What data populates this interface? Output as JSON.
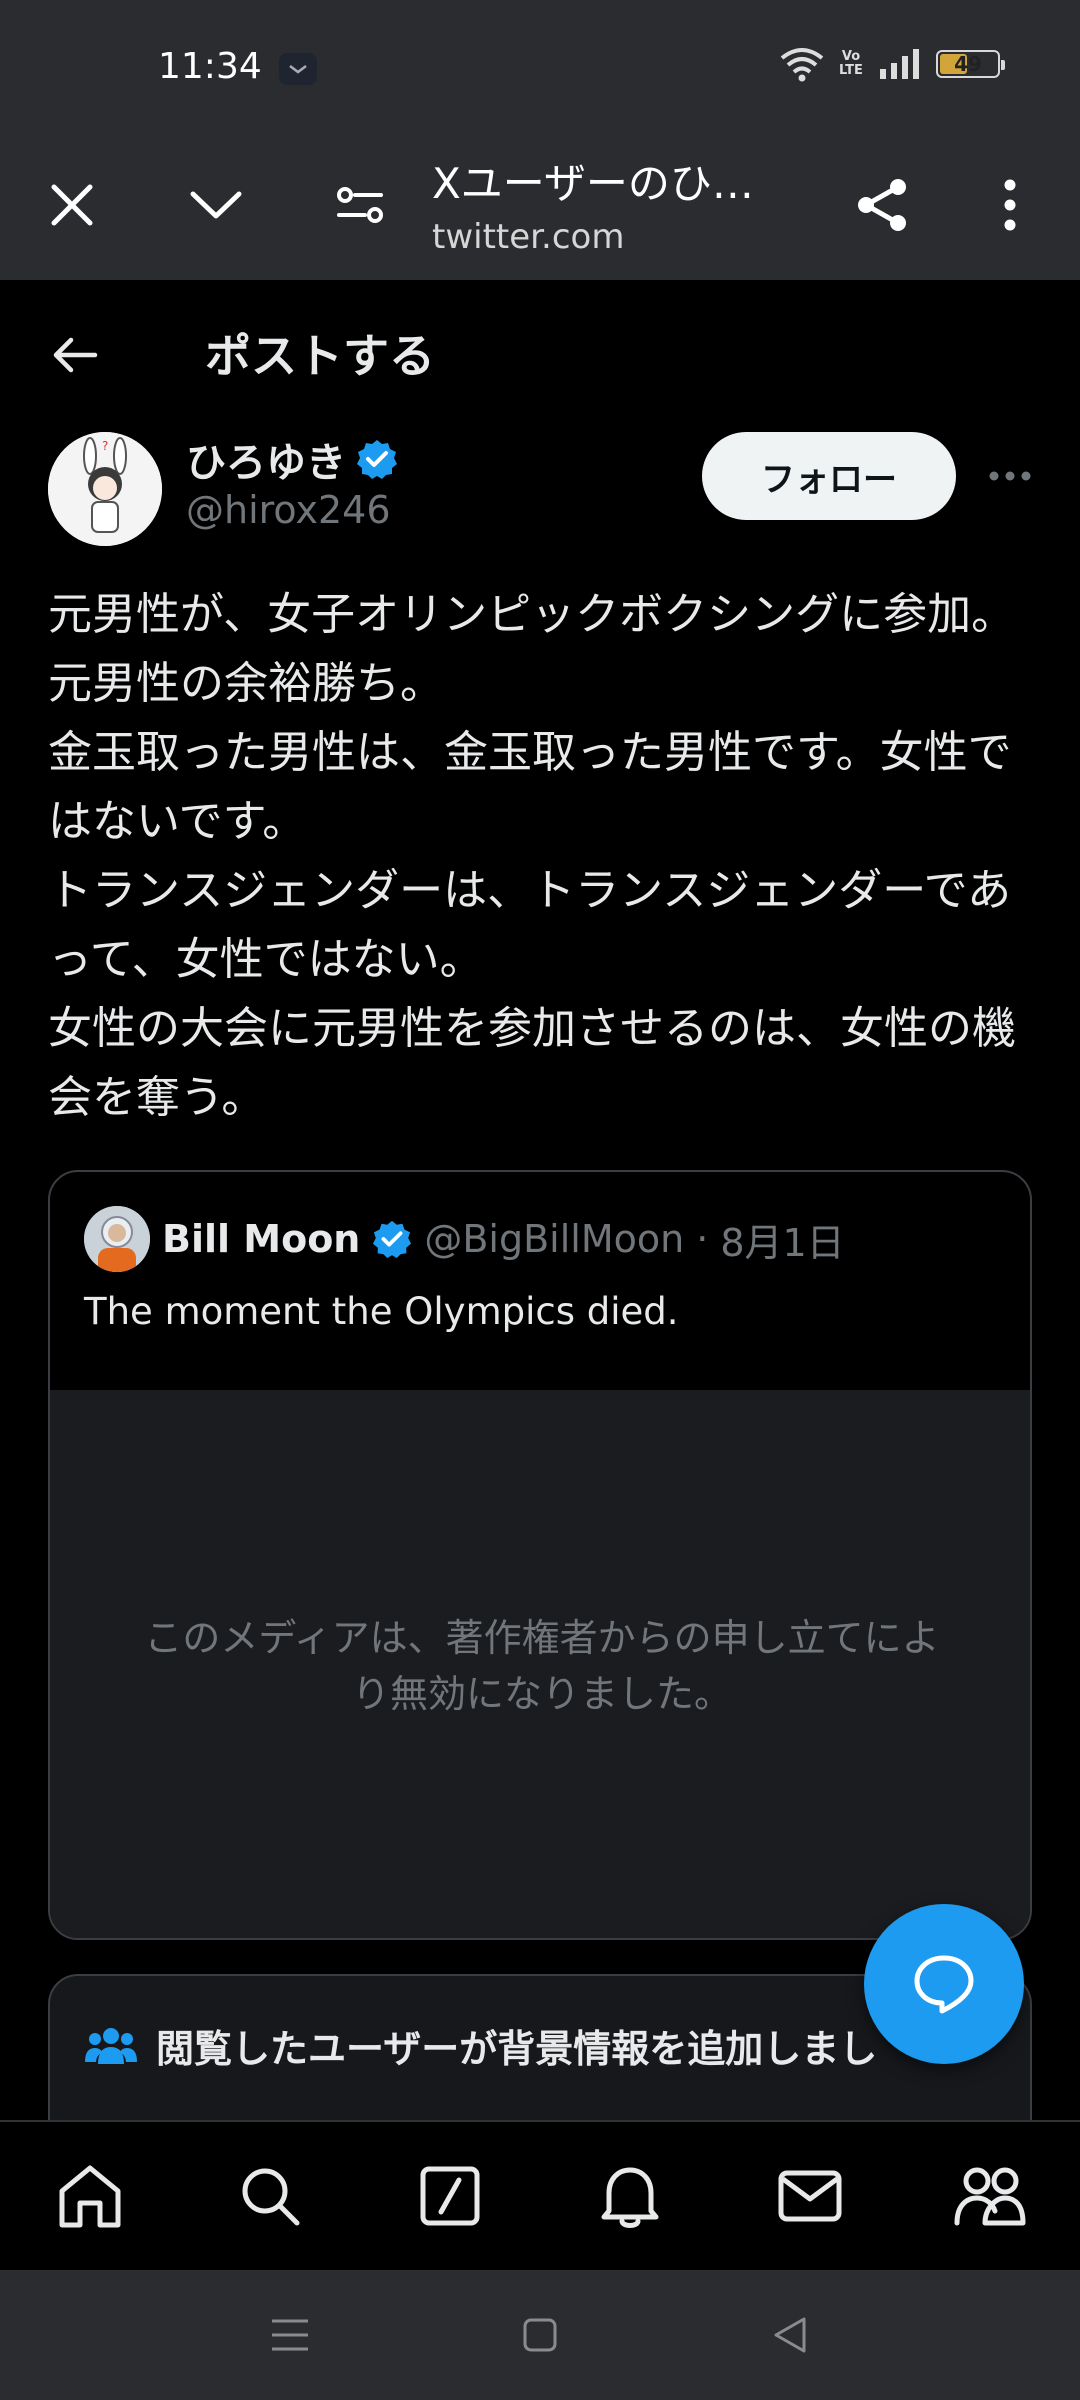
{
  "status_bar": {
    "time": "11:34",
    "battery": "49",
    "battery_level": 0.49,
    "network_label": "Vo LTE"
  },
  "browser": {
    "title": "Xユーザーのひ…",
    "url": "twitter.com",
    "icons": [
      "close-icon",
      "chevron-down-icon",
      "site-settings-icon",
      "share-icon",
      "more-vertical-icon"
    ]
  },
  "header": {
    "title": "ポストする"
  },
  "author": {
    "name": "ひろゆき",
    "handle": "@hirox246",
    "follow_label": "フォロー"
  },
  "post": {
    "lines": [
      "元男性が、女子オリンピックボクシングに参加。元男性の余裕勝ち。",
      "金玉取った男性は、金玉取った男性です。女性ではないです。",
      "トランスジェンダーは、トランスジェンダーであって、女性ではない。",
      "女性の大会に元男性を参加させるのは、女性の機会を奪う。"
    ]
  },
  "quote": {
    "name": "Bill Moon",
    "handle": "@BigBillMoon",
    "separator": "·",
    "date": "8月1日",
    "text": "The moment the Olympics died.",
    "media_notice": "このメディアは、著作権者からの申し立てにより無効になりました。"
  },
  "community_note": {
    "title": "閲覧したユーザーが背景情報を追加しまし"
  },
  "colors": {
    "accent": "#1d9bf0",
    "background": "#000000",
    "chrome": "#2b2c30",
    "secondary_text": "#71767b"
  },
  "bottom_nav": [
    "home-icon",
    "search-icon",
    "grok-icon",
    "notifications-icon",
    "messages-icon",
    "communities-icon"
  ]
}
